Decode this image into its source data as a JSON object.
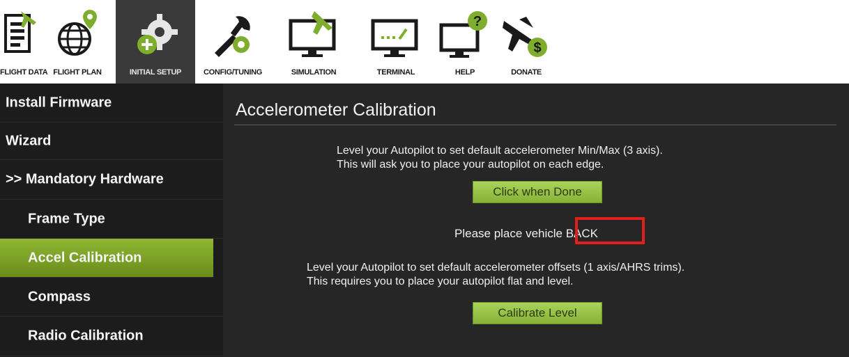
{
  "toolbar": {
    "items": [
      {
        "label": "FLIGHT DATA",
        "icon": "flight-data-icon"
      },
      {
        "label": "FLIGHT PLAN",
        "icon": "flight-plan-icon"
      },
      {
        "label": "INITIAL SETUP",
        "icon": "initial-setup-icon"
      },
      {
        "label": "CONFIG/TUNING",
        "icon": "config-tuning-icon"
      },
      {
        "label": "SIMULATION",
        "icon": "simulation-icon"
      },
      {
        "label": "TERMINAL",
        "icon": "terminal-icon"
      },
      {
        "label": "HELP",
        "icon": "help-icon"
      },
      {
        "label": "DONATE",
        "icon": "donate-icon"
      }
    ],
    "active_index": 2
  },
  "sidebar": {
    "items": [
      {
        "label": "Install Firmware"
      },
      {
        "label": "Wizard"
      },
      {
        "label": ">> Mandatory Hardware"
      },
      {
        "label": "Frame Type"
      },
      {
        "label": "Accel Calibration"
      },
      {
        "label": "Compass"
      },
      {
        "label": "Radio Calibration"
      }
    ],
    "active_index": 4
  },
  "main": {
    "title": "Accelerometer Calibration",
    "accel_line1": "Level your Autopilot to set default accelerometer Min/Max (3 axis).",
    "accel_line2": "This will ask you to place your autopilot on each edge.",
    "click_when_done_label": "Click when Done",
    "status_text": "Please place vehicle BACK",
    "level_line1": "Level your Autopilot to set default accelerometer offsets (1 axis/AHRS trims).",
    "level_line2": "This requires you to place your autopilot flat and level.",
    "calibrate_level_label": "Calibrate Level"
  },
  "colors": {
    "accent_green": "#8fb633",
    "sidebar_bg": "#1c1c1c",
    "main_bg": "#262626",
    "highlight_red": "#e0201d"
  }
}
